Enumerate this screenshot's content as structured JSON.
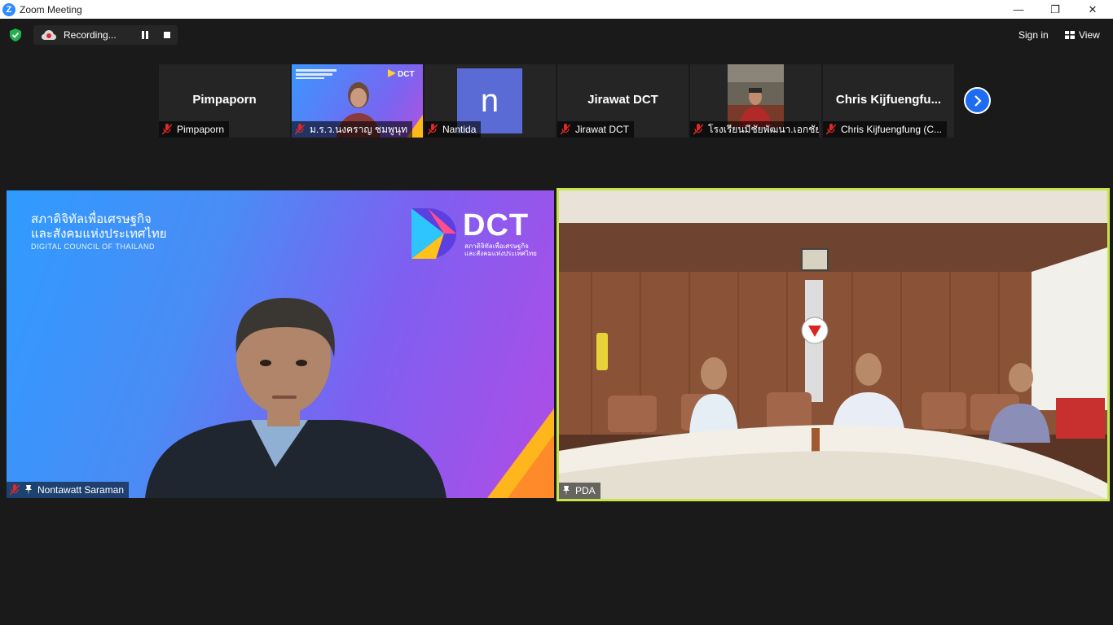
{
  "window": {
    "title": "Zoom Meeting",
    "minimize": "—",
    "restore": "❐",
    "close": "✕",
    "logo_letter": "Z"
  },
  "toolbar": {
    "recording_label": "Recording...",
    "signin_label": "Sign in",
    "view_label": "View"
  },
  "thumbnails": [
    {
      "display": "Pimpaporn",
      "label": "Pimpaporn",
      "type": "name"
    },
    {
      "display": "",
      "label": "ม.ร.ว.นงคราญ ชมพูนุท",
      "type": "video"
    },
    {
      "display": "n",
      "label": "Nantida",
      "type": "avatar"
    },
    {
      "display": "Jirawat DCT",
      "label": "Jirawat DCT",
      "type": "name"
    },
    {
      "display": "",
      "label": "โรงเรียนมีชัยพัฒนา.เอกชัย",
      "type": "video"
    },
    {
      "display": "Chris  Kijfuengfu...",
      "label": "Chris Kijfuengfung (C...",
      "type": "name"
    }
  ],
  "main_left": {
    "label": "Nontawatt Saraman",
    "thai_line1": "สภาดิจิทัลเพื่อเศรษฐกิจ",
    "thai_line2": "และสังคมแห่งประเทศไทย",
    "english": "DIGITAL COUNCIL OF THAILAND",
    "logo_word": "DCT",
    "logo_sub1": "สภาดิจิทัลเพื่อเศรษฐกิจ",
    "logo_sub2": "และสังคมแห่งประเทศไทย"
  },
  "main_right": {
    "label": "PDA"
  },
  "colors": {
    "active_speaker": "#c8e64a",
    "accent": "#1e6cf2",
    "muted": "#e02828"
  }
}
